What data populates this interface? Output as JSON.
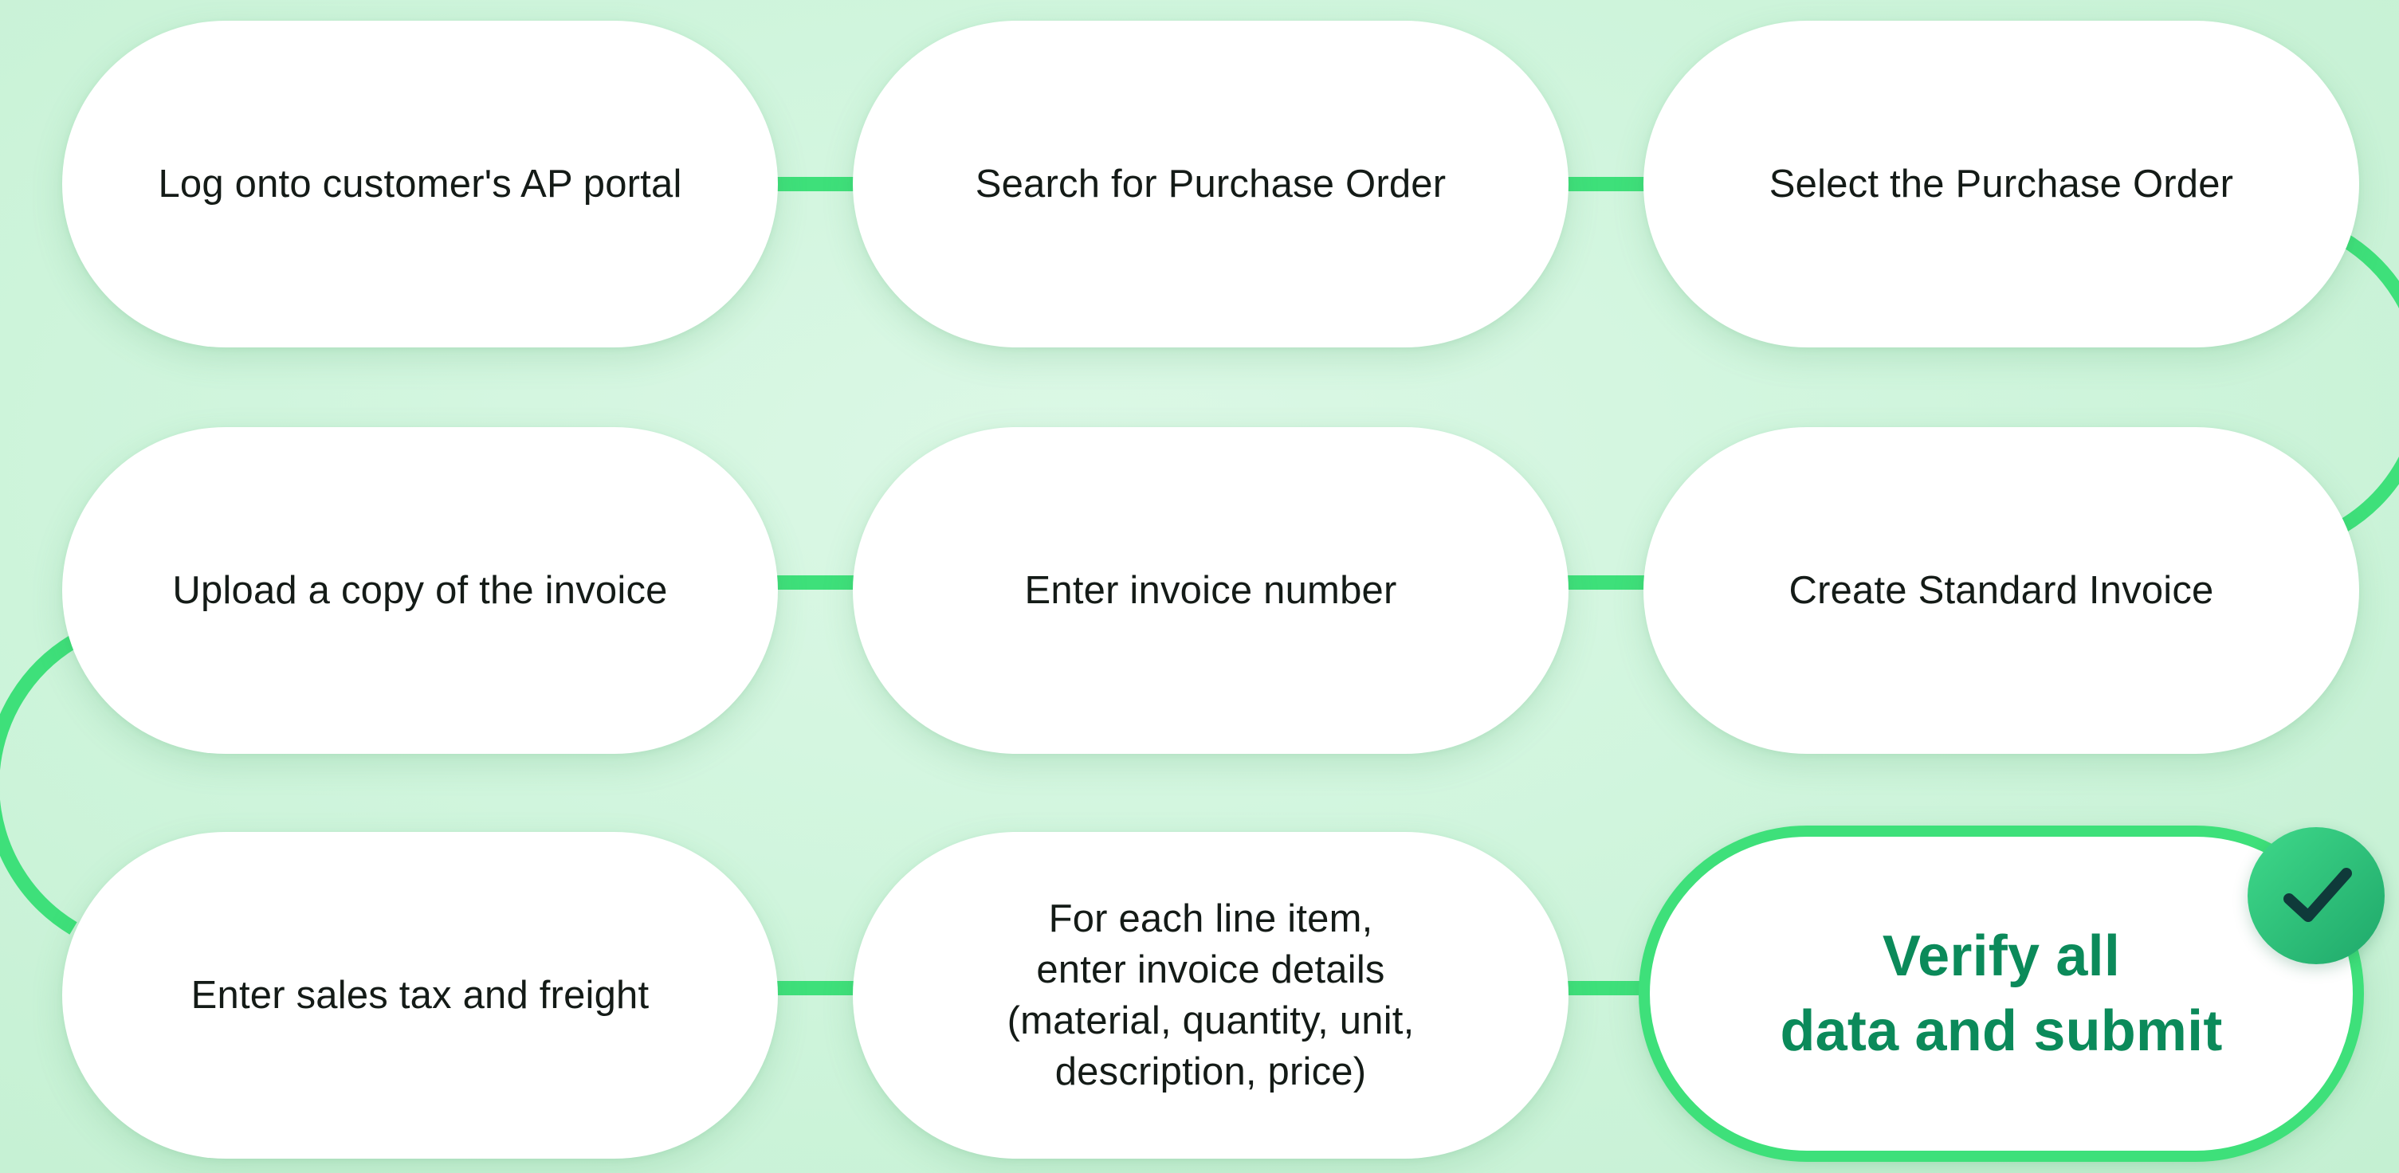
{
  "steps": [
    {
      "label": "Log onto customer's AP portal"
    },
    {
      "label": "Search for Purchase Order"
    },
    {
      "label": "Select the Purchase Order"
    },
    {
      "label": "Create Standard Invoice"
    },
    {
      "label": "Enter invoice number"
    },
    {
      "label": "Upload a copy of the invoice"
    },
    {
      "label": "Enter sales tax and freight"
    },
    {
      "label": "For each line item,\nenter invoice details\n(material, quantity, unit,\ndescription, price)"
    },
    {
      "label": "Verify all\ndata and submit",
      "final": true
    }
  ],
  "colors": {
    "connector": "#3ee07a",
    "final_text": "#0b8a5a",
    "badge": "#2cc27a",
    "check_mark": "#0f3a3a"
  },
  "icons": {
    "complete": "checkmark-icon"
  }
}
